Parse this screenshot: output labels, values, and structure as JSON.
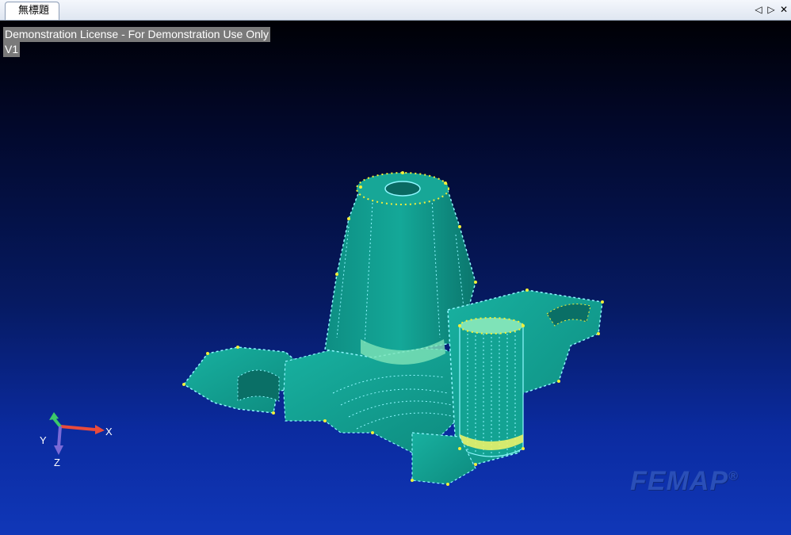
{
  "tab": {
    "title": "無標題",
    "prev_glyph": "◁",
    "next_glyph": "▷",
    "close_glyph": "✕"
  },
  "viewport": {
    "license_text": "Demonstration License - For Demonstration Use Only",
    "view_name": "V1",
    "logo_text": "FEMAP",
    "logo_mark": "®"
  },
  "triad": {
    "x_label": "X",
    "y_label": "Y",
    "z_label": "Z"
  },
  "colors": {
    "mesh_fill": "#12a494",
    "mesh_fill_dark": "#0b7c72",
    "mesh_highlight": "#7fe3b8",
    "node_yellow": "#f2ef3a",
    "edge_cyan": "#8ff7ff"
  }
}
